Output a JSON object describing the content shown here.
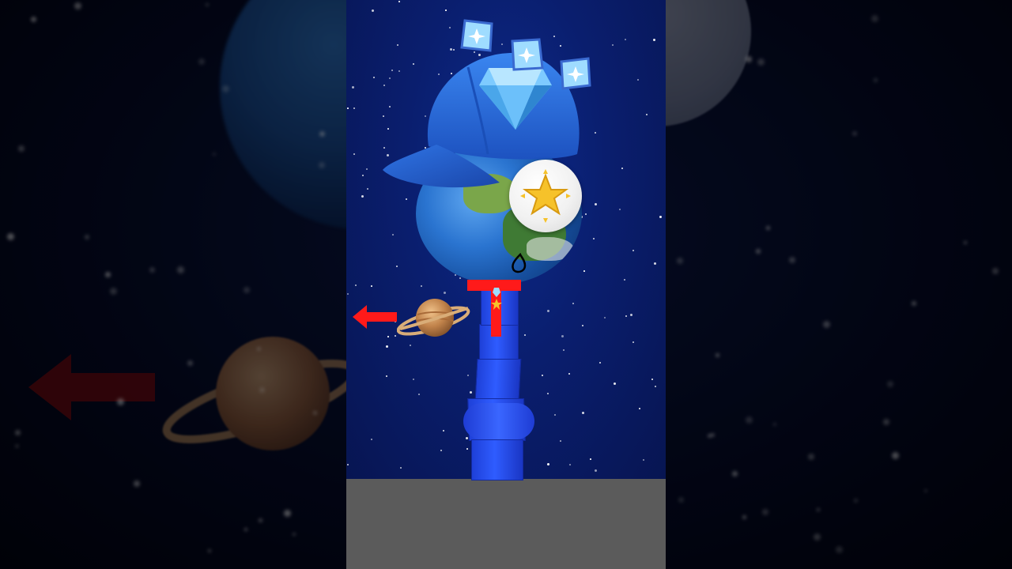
{
  "scene": {
    "colors": {
      "space": "#0a1e6e",
      "tower": "#2f5cff",
      "marker": "#ff1a1a",
      "ground": "#5b5b5b",
      "arrow": "#ff1a1a",
      "cap": "#2a6fe0"
    },
    "icons": [
      "diamond-gem-icon",
      "crystal-cube-icon",
      "baseball-cap-icon",
      "earth-globe-icon",
      "star-badge-icon",
      "ringed-planet-icon",
      "left-arrow-icon",
      "ink-drop-icon"
    ]
  }
}
